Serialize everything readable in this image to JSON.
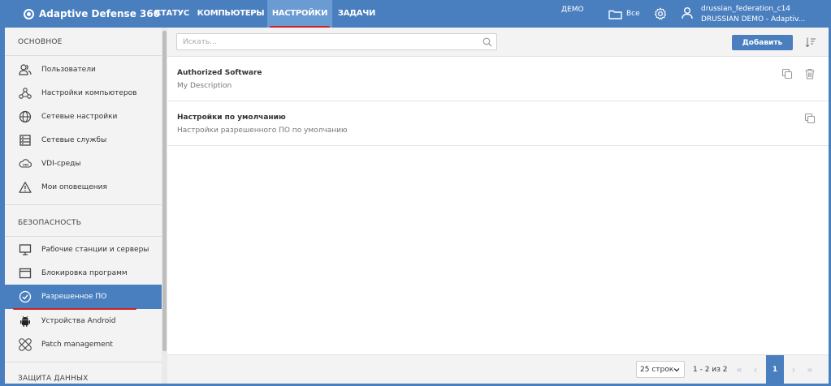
{
  "app": {
    "brand": "Adaptive Defense 360",
    "nav_tabs": [
      {
        "label": "СТАТУС"
      },
      {
        "label": "КОМПЬЮТЕРЫ"
      },
      {
        "label": "НАСТРОЙКИ",
        "active": true
      },
      {
        "label": "ЗАДАЧИ"
      }
    ],
    "demo_label": "ДЕМО",
    "folder_label": "Все",
    "user": {
      "login": "drussian_federation_c14",
      "account": "DRUSSIAN DEMO - Adaptiv..."
    }
  },
  "sidebar": {
    "sections": [
      {
        "title": "ОСНОВНОЕ",
        "items": [
          {
            "label": "Пользователи",
            "icon": "users-icon"
          },
          {
            "label": "Настройки компьютеров",
            "icon": "computer-settings-icon"
          },
          {
            "label": "Сетевые настройки",
            "icon": "globe-icon"
          },
          {
            "label": "Сетевые службы",
            "icon": "server-icon"
          },
          {
            "label": "VDI-среды",
            "icon": "vdi-cloud-icon"
          },
          {
            "label": "Мои оповещения",
            "icon": "warning-icon"
          }
        ]
      },
      {
        "title": "БЕЗОПАСНОСТЬ",
        "items": [
          {
            "label": "Рабочие станции и серверы",
            "icon": "monitor-icon"
          },
          {
            "label": "Блокировка программ",
            "icon": "window-icon"
          },
          {
            "label": "Разрешенное ПО",
            "icon": "check-circle-icon",
            "active": true
          },
          {
            "label": "Устройства Android",
            "icon": "android-icon"
          },
          {
            "label": "Patch management",
            "icon": "patch-icon"
          }
        ]
      },
      {
        "title": "ЗАЩИТА ДАННЫХ",
        "items": []
      }
    ]
  },
  "toolbar": {
    "search_placeholder": "Искать...",
    "add_label": "Добавить"
  },
  "list": {
    "rows": [
      {
        "title": "Authorized Software",
        "description": "My Description",
        "actions": [
          "copy-icon",
          "trash-icon"
        ]
      },
      {
        "title": "Настройки по умолчанию",
        "description": "Настройки разрешенного ПО по умолчанию",
        "actions": [
          "copy-icon"
        ]
      }
    ]
  },
  "pagination": {
    "rows_per_page": "25 строк",
    "range_text": "1 - 2 из 2",
    "current_page": "1"
  },
  "colors": {
    "primary": "#4a7fbf",
    "accent_underline": "#cc2222",
    "sidebar_bg": "#f3f3f3"
  }
}
